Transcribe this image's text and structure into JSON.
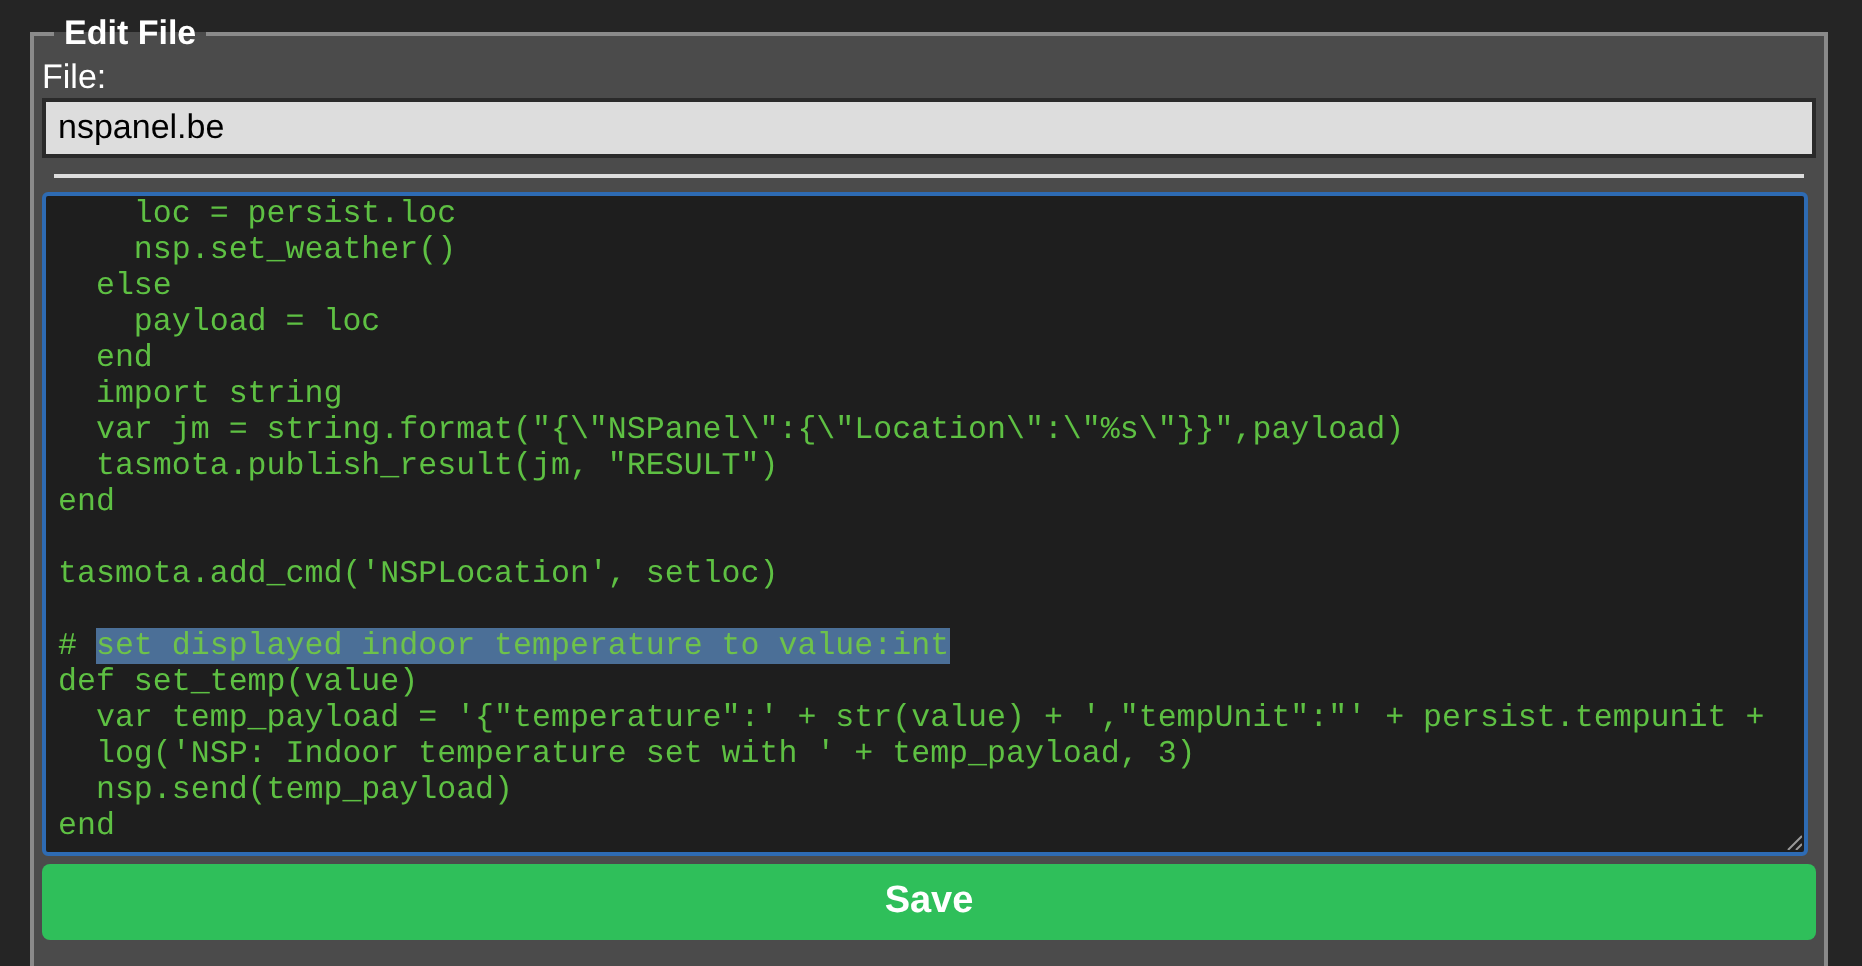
{
  "legend": "Edit File",
  "file_label": "File:",
  "file_field": {
    "value": "nspanel.be"
  },
  "editor": {
    "lines": [
      {
        "kind": "code",
        "text": "    loc = persist.loc"
      },
      {
        "kind": "code",
        "text": "    nsp.set_weather()"
      },
      {
        "kind": "code",
        "text": "  else"
      },
      {
        "kind": "code",
        "text": "    payload = loc"
      },
      {
        "kind": "code",
        "text": "  end"
      },
      {
        "kind": "code",
        "text": "  import string"
      },
      {
        "kind": "code",
        "text": "  var jm = string.format(\"{\\\"NSPanel\\\":{\\\"Location\\\":\\\"%s\\\"}}\",payload)"
      },
      {
        "kind": "code",
        "text": "  tasmota.publish_result(jm, \"RESULT\")"
      },
      {
        "kind": "code",
        "text": "end"
      },
      {
        "kind": "blank"
      },
      {
        "kind": "code",
        "text": "tasmota.add_cmd('NSPLocation', setloc)"
      },
      {
        "kind": "blank"
      },
      {
        "kind": "code",
        "text": "# ",
        "selection": "set displayed indoor temperature to value:int"
      },
      {
        "kind": "code",
        "text": "def set_temp(value)"
      },
      {
        "kind": "code",
        "text": "  var temp_payload = '{\"temperature\":' + str(value) + ',\"tempUnit\":\"' + persist.tempunit +"
      },
      {
        "kind": "code",
        "text": "  log('NSP: Indoor temperature set with ' + temp_payload, 3)"
      },
      {
        "kind": "code",
        "text": "  nsp.send(temp_payload)"
      },
      {
        "kind": "code",
        "text": "end"
      }
    ]
  },
  "save_button": "Save"
}
